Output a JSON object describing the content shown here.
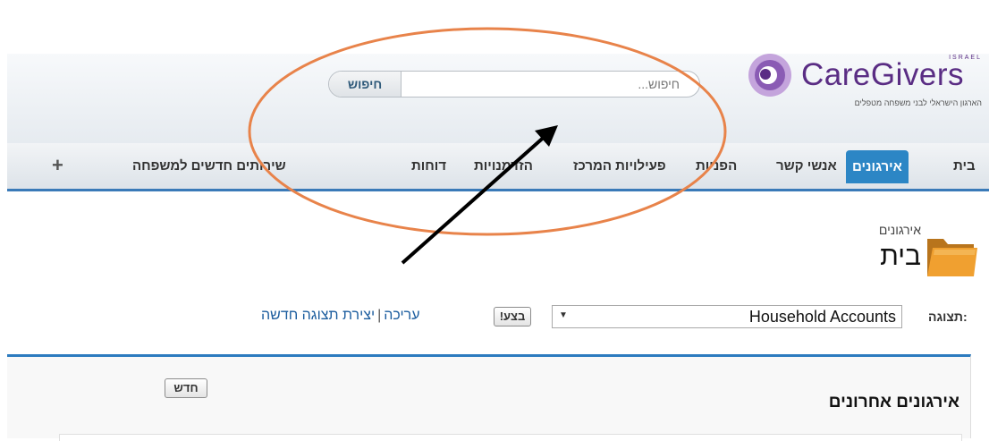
{
  "header": {
    "search_button": "חיפוש",
    "search_placeholder": "חיפוש...",
    "logo_name": "CareGivers",
    "logo_country": "ISRAEL",
    "logo_tagline": "הארגון הישראלי לבני משפחה מטפלים"
  },
  "tabs": [
    {
      "label": "בית",
      "active": false
    },
    {
      "label": "אירגונים",
      "active": true
    },
    {
      "label": "אנשי קשר",
      "active": false
    },
    {
      "label": "הפניות",
      "active": false
    },
    {
      "label": "פעילויות המרכז",
      "active": false
    },
    {
      "label": "הזדמנויות",
      "active": false
    },
    {
      "label": "דוחות",
      "active": false
    },
    {
      "label": "שירותים חדשים למשפחה",
      "active": false
    },
    {
      "label": "+",
      "active": false
    }
  ],
  "page": {
    "subtitle": "אירגונים",
    "title": "בית"
  },
  "view": {
    "label": "תצוגה:",
    "selected": "Household Accounts",
    "go_button": "בצע!",
    "edit_link": "עריכה",
    "separator": "|",
    "create_link": "יצירת תצוגה חדשה"
  },
  "recent": {
    "title": "אירגונים אחרונים",
    "new_button": "חדש"
  },
  "colors": {
    "accent_blue": "#2c86c5",
    "annotation_orange": "#e8834a",
    "logo_purple": "#5a2d84"
  },
  "icons": {
    "folder": "folder-icon",
    "dropdown": "chevron-down-icon",
    "annotation_arrow": "arrow-icon"
  }
}
